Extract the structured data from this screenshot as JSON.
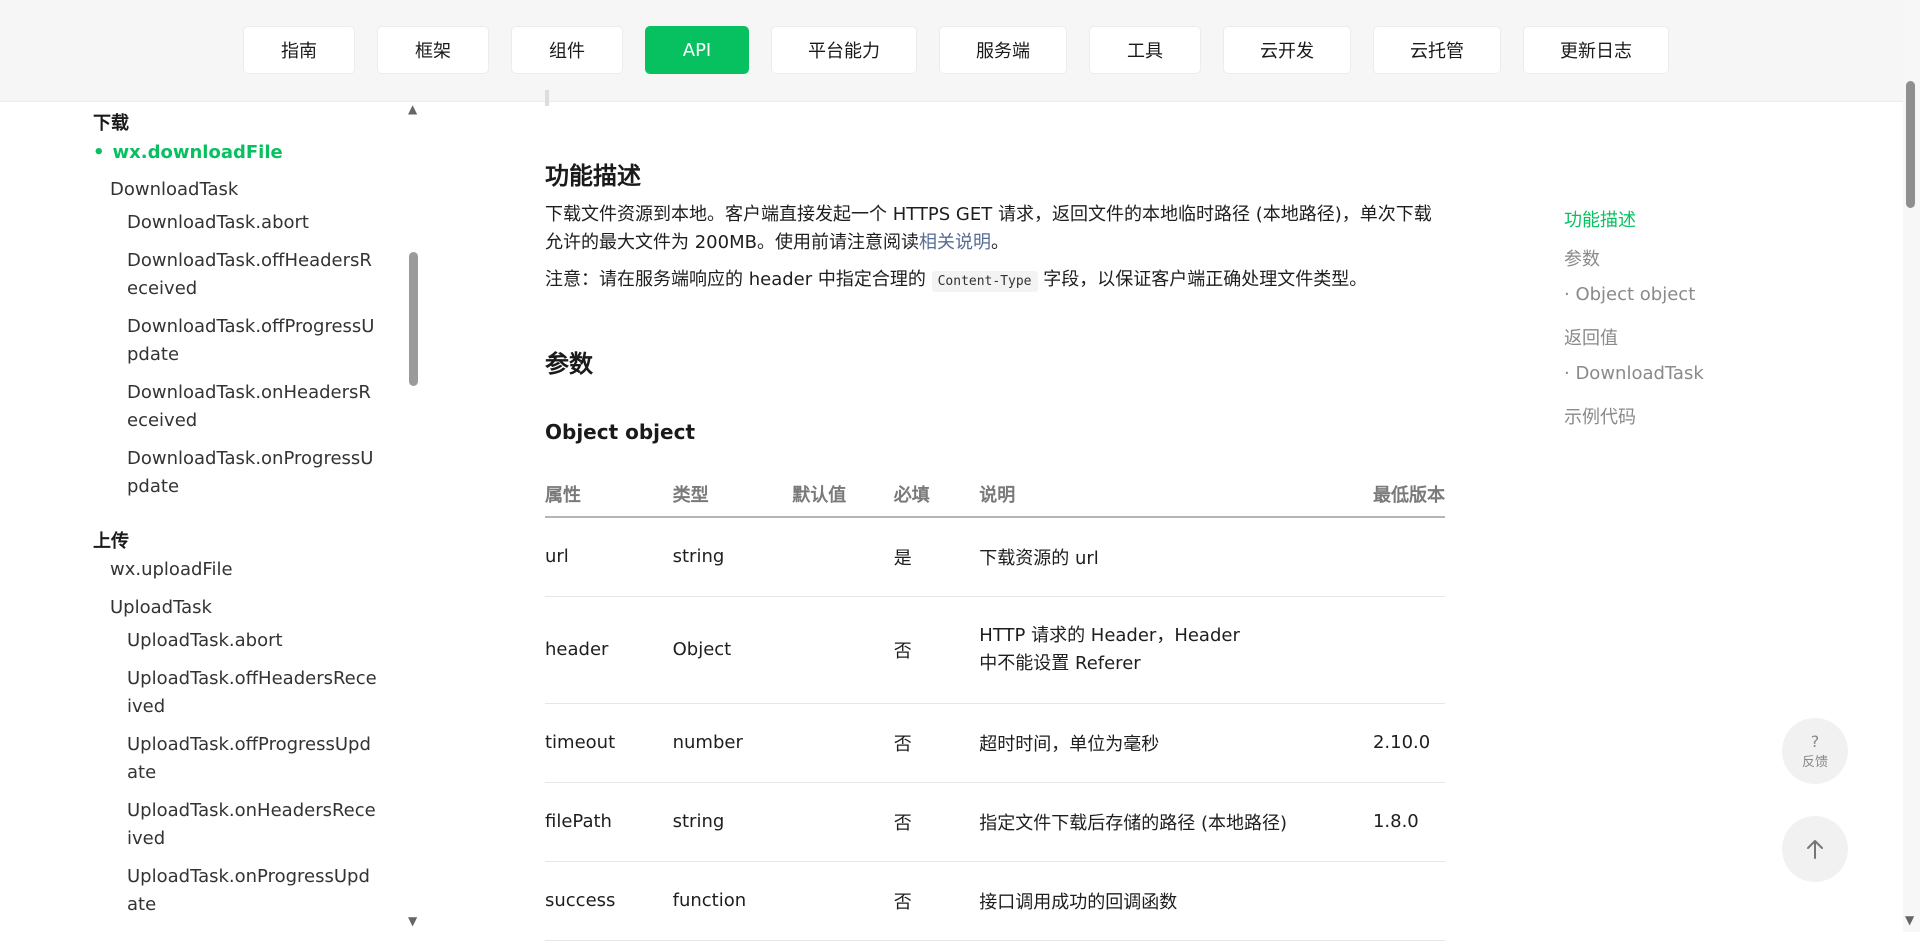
{
  "nav": {
    "tabs": [
      {
        "label": "指南"
      },
      {
        "label": "框架"
      },
      {
        "label": "组件"
      },
      {
        "label": "API"
      },
      {
        "label": "平台能力"
      },
      {
        "label": "服务端"
      },
      {
        "label": "工具"
      },
      {
        "label": "云开发"
      },
      {
        "label": "云托管"
      },
      {
        "label": "更新日志"
      }
    ],
    "active": "API"
  },
  "sidebar": {
    "groups": [
      {
        "label": "下载"
      },
      {
        "label": "上传"
      }
    ],
    "download_items": [
      {
        "label": "wx.downloadFile"
      },
      {
        "label": "DownloadTask"
      },
      {
        "label": "DownloadTask.abort"
      },
      {
        "label": "DownloadTask.offHeadersReceived"
      },
      {
        "label": "DownloadTask.offProgressUpdate"
      },
      {
        "label": "DownloadTask.onHeadersReceived"
      },
      {
        "label": "DownloadTask.onProgressUpdate"
      }
    ],
    "upload_items": [
      {
        "label": "wx.uploadFile"
      },
      {
        "label": "UploadTask"
      },
      {
        "label": "UploadTask.abort"
      },
      {
        "label": "UploadTask.offHeadersReceived"
      },
      {
        "label": "UploadTask.offProgressUpdate"
      },
      {
        "label": "UploadTask.onHeadersReceived"
      },
      {
        "label": "UploadTask.onProgressUpdate"
      }
    ]
  },
  "content": {
    "desc_title": "功能描述",
    "desc_text_1": "下载文件资源到本地。客户端直接发起一个 HTTPS GET 请求，返回文件的本地临时路径 (本地路径)，单次下载允许的最大文件为 200MB。使用前请注意阅读",
    "desc_link": "相关说明",
    "desc_text_1_end": "。",
    "note_prefix": "注意：请在服务端响应的 header 中指定合理的",
    "note_code": "Content-Type",
    "note_suffix": "字段，以保证客户端正确处理文件类型。",
    "params_title": "参数",
    "object_title": "Object object",
    "table": {
      "headers": [
        "属性",
        "类型",
        "默认值",
        "必填",
        "说明",
        "最低版本"
      ],
      "rows": [
        {
          "name": "url",
          "type": "string",
          "default": "",
          "required": "是",
          "desc": "下载资源的 url",
          "version": ""
        },
        {
          "name": "header",
          "type": "Object",
          "default": "",
          "required": "否",
          "desc": "HTTP 请求的 Header，Header 中不能设置 Referer",
          "version": ""
        },
        {
          "name": "timeout",
          "type": "number",
          "default": "",
          "required": "否",
          "desc": "超时时间，单位为毫秒",
          "version": "2.10.0"
        },
        {
          "name": "filePath",
          "type": "string",
          "default": "",
          "required": "否",
          "desc": "指定文件下载后存储的路径 (本地路径)",
          "version": "1.8.0"
        },
        {
          "name": "success",
          "type": "function",
          "default": "",
          "required": "否",
          "desc": "接口调用成功的回调函数",
          "version": ""
        }
      ]
    }
  },
  "toc": {
    "items": [
      {
        "label": "功能描述"
      },
      {
        "label": "参数"
      },
      {
        "label": "· Object object"
      },
      {
        "label": "返回值"
      },
      {
        "label": "· DownloadTask"
      },
      {
        "label": "示例代码"
      }
    ]
  },
  "float": {
    "feedback_q": "?",
    "feedback_label": "反馈"
  },
  "colors": {
    "accent": "#07c160",
    "link": "#576b95"
  }
}
